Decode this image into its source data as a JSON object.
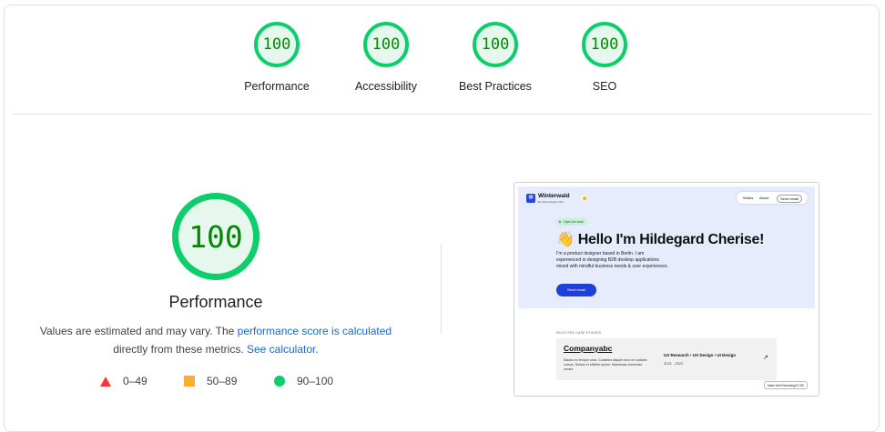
{
  "summary": {
    "gauges": [
      {
        "score": "100",
        "label": "Performance"
      },
      {
        "score": "100",
        "label": "Accessibility"
      },
      {
        "score": "100",
        "label": "Best Practices"
      },
      {
        "score": "100",
        "label": "SEO"
      }
    ]
  },
  "performance": {
    "score": "100",
    "title": "Performance",
    "desc_prefix": "Values are estimated and may vary. The ",
    "score_link": "performance score is calculated",
    "desc_middle": " directly from these metrics. ",
    "calc_link": "See calculator.",
    "legend": [
      {
        "range": "0–49",
        "shape": "triangle-icon"
      },
      {
        "range": "50–89",
        "shape": "square-icon"
      },
      {
        "range": "90–100",
        "shape": "circle-icon"
      }
    ]
  },
  "thumbnail": {
    "brand": "Winterwald",
    "brand_sub": "By Ravenbright CSS",
    "nav": {
      "works": "Works",
      "about": "About",
      "email": "Send email"
    },
    "pill": "Open for work",
    "headline": "👋 Hello I'm Hildegard Cherise!",
    "intro": "I'm a product designer based in Berlin. I am experienced in designing B2B desktop applications mixed with mindful business needs & user experiences.",
    "send_button": "Send email",
    "cases_label": "SELECTED CASE STUDIES",
    "card": {
      "name": "Companyabc",
      "desc": "Mauris eu tempor urna. Curabitur aliquet nunc mi sodales cursus. Nullam et efficitur ipsum. Maecenas commodo ornare.",
      "tags": "UX Research • UX Design • UI Design",
      "years": "2021 - 2022",
      "arrow": "↗"
    },
    "made_with": "Made with Ravenbright CSS"
  },
  "colors": {
    "pass": "#0cce6b",
    "average": "#ffaa33",
    "fail": "#ff3333",
    "link": "#1967d2"
  }
}
